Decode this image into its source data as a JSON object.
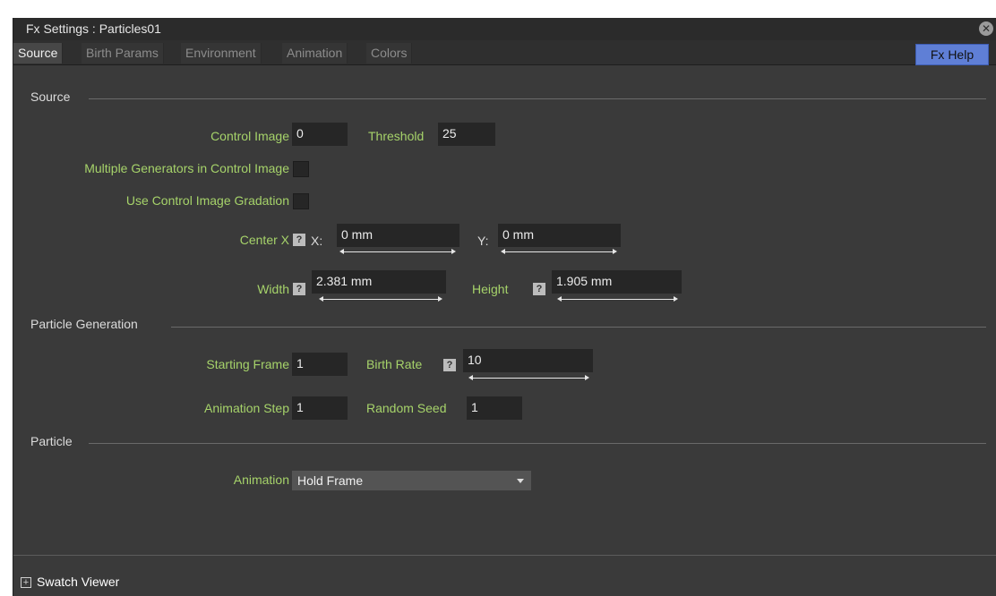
{
  "window": {
    "title": "Fx Settings : Particles01"
  },
  "tabs": [
    "Source",
    "Birth Params",
    "Environment",
    "Animation",
    "Colors"
  ],
  "fx_help_label": "Fx Help",
  "sections": {
    "source": "Source",
    "particle_generation": "Particle Generation",
    "particle": "Particle"
  },
  "source": {
    "control_image_label": "Control Image",
    "control_image_value": "0",
    "threshold_label": "Threshold",
    "threshold_value": "25",
    "multiple_generators_label": "Multiple Generators in Control Image",
    "use_gradation_label": "Use Control Image Gradation",
    "center_x_label": "Center X",
    "x_axis_label": "X:",
    "x_value": "0 mm",
    "y_axis_label": "Y:",
    "y_value": "0 mm",
    "width_label": "Width",
    "width_value": "2.381 mm",
    "height_label": "Height",
    "height_value": "1.905 mm"
  },
  "particle_generation": {
    "starting_frame_label": "Starting Frame",
    "starting_frame_value": "1",
    "birth_rate_label": "Birth Rate",
    "birth_rate_value": "10",
    "animation_step_label": "Animation Step",
    "animation_step_value": "1",
    "random_seed_label": "Random Seed",
    "random_seed_value": "1"
  },
  "particle": {
    "animation_label": "Animation",
    "animation_value": "Hold Frame"
  },
  "footer": {
    "swatch_viewer_label": "Swatch Viewer"
  },
  "colors": {
    "label_green": "#a6d36a",
    "fx_help_blue": "#5f7fd6",
    "panel_bg": "#3a3a3a"
  },
  "icons": {
    "close": "close-icon",
    "lock": "lock-icon",
    "dropdown": "chevron-down-icon",
    "expand": "plus-icon"
  }
}
